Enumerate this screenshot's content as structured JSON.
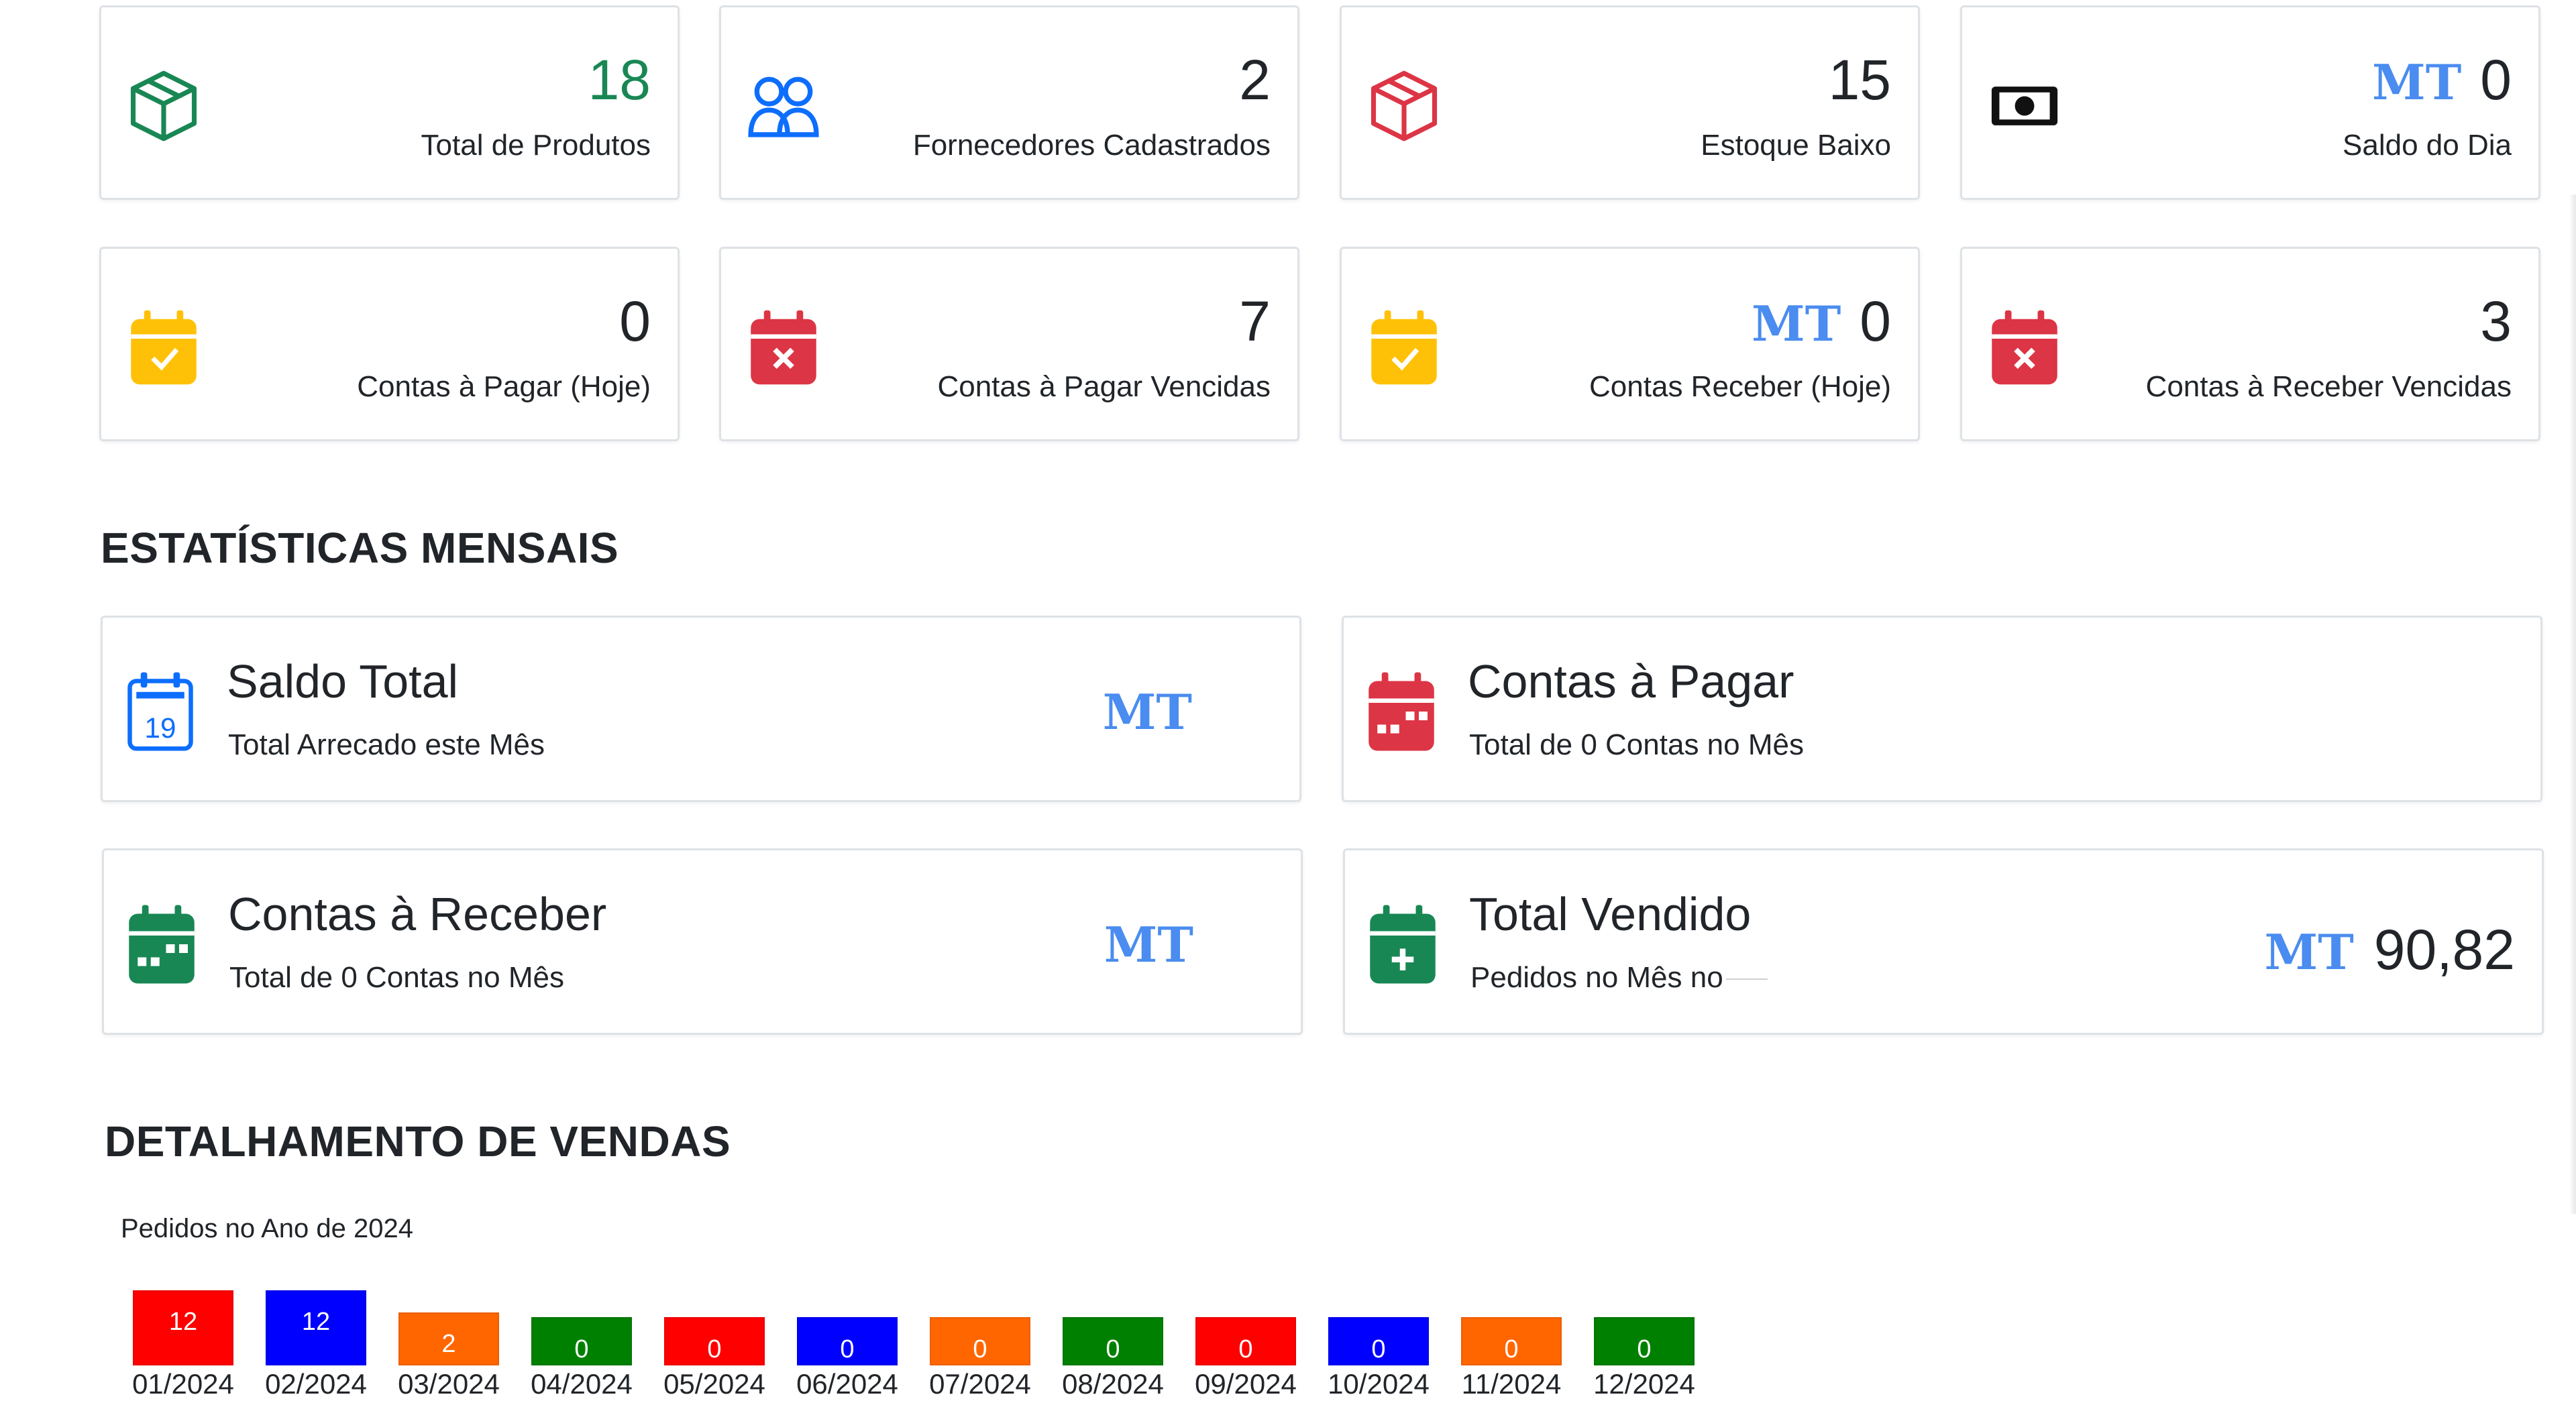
{
  "stats": [
    {
      "value": "18",
      "label": "Total de Produtos",
      "icon": "box-icon",
      "color": "#198754",
      "mt": ""
    },
    {
      "value": "2",
      "label": "Fornecedores Cadastrados",
      "icon": "people-icon",
      "color": "#0d6efd",
      "mt": ""
    },
    {
      "value": "15",
      "label": "Estoque Baixo",
      "icon": "box-icon",
      "color": "#dc3545",
      "mt": ""
    },
    {
      "value": "0",
      "label": "Saldo do Dia",
      "icon": "cash-icon",
      "color": "#111111",
      "mt": "MT"
    },
    {
      "value": "0",
      "label": "Contas à Pagar (Hoje)",
      "icon": "calendar-check-icon",
      "color": "#ffc107",
      "mt": ""
    },
    {
      "value": "7",
      "label": "Contas à Pagar Vencidas",
      "icon": "calendar-x-icon",
      "color": "#dc3545",
      "mt": ""
    },
    {
      "value": "0",
      "label": "Contas Receber (Hoje)",
      "icon": "calendar-check-icon",
      "color": "#ffc107",
      "mt": "MT"
    },
    {
      "value": "3",
      "label": "Contas à Receber Vencidas",
      "icon": "calendar-x-icon",
      "color": "#dc3545",
      "mt": ""
    }
  ],
  "monthly": {
    "title": "ESTATÍSTICAS MENSAIS",
    "cards": [
      {
        "title": "Saldo Total",
        "subtitle": "Total Arrecado este Mês",
        "mt": "MT",
        "value": "",
        "icon": "calendar-19-icon",
        "color": "#0d6efd"
      },
      {
        "title": "Contas à Pagar",
        "subtitle": "Total de 0 Contas no Mês",
        "mt": "",
        "value": "",
        "icon": "calendar-event-icon",
        "color": "#dc3545"
      },
      {
        "title": "Contas à Receber",
        "subtitle": "Total de 0 Contas no Mês",
        "mt": "MT",
        "value": "",
        "icon": "calendar-event-icon",
        "color": "#198754"
      },
      {
        "title": "Total Vendido",
        "subtitle": "Pedidos no Mês no",
        "mt": "MT",
        "value": "90,82",
        "icon": "calendar-plus-icon",
        "color": "#198754"
      }
    ]
  },
  "sales": {
    "title": "DETALHAMENTO DE VENDAS",
    "subtitle": "Pedidos no Ano de 2024"
  },
  "chart_data": {
    "type": "bar",
    "categories": [
      "01/2024",
      "02/2024",
      "03/2024",
      "04/2024",
      "05/2024",
      "06/2024",
      "07/2024",
      "08/2024",
      "09/2024",
      "10/2024",
      "11/2024",
      "12/2024"
    ],
    "values": [
      12,
      12,
      2,
      0,
      0,
      0,
      0,
      0,
      0,
      0,
      0,
      0
    ],
    "colors": [
      "#ff0000",
      "#0000ff",
      "#ff6600",
      "#008000",
      "#ff0000",
      "#0000ff",
      "#ff6600",
      "#008000",
      "#ff0000",
      "#0000ff",
      "#ff6600",
      "#008000"
    ],
    "title": "Pedidos no Ano de 2024"
  }
}
